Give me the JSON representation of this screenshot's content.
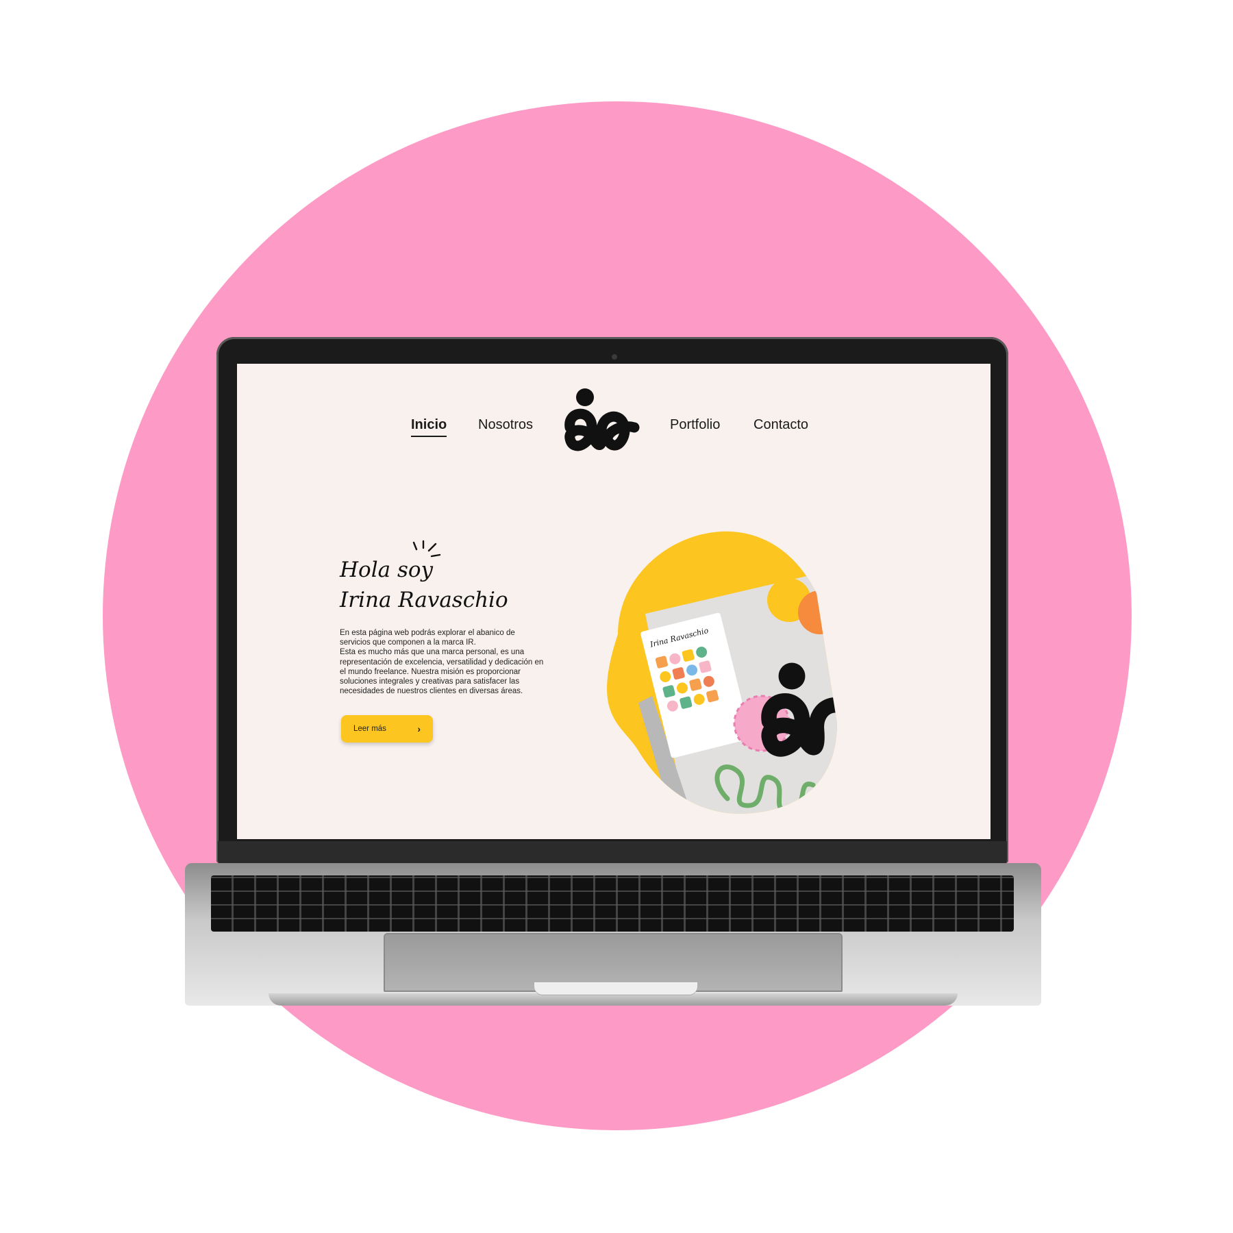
{
  "nav": {
    "items": [
      {
        "label": "Inicio",
        "active": true
      },
      {
        "label": "Nosotros"
      },
      {
        "label": "Portfolio"
      },
      {
        "label": "Contacto"
      }
    ]
  },
  "hero": {
    "greeting_line1": "Hola soy",
    "greeting_line2": "Irina Ravaschio",
    "intro": "En esta página web podrás explorar el abanico de servicios que componen a la marca IR.\nEsta es mucho más que una marca personal, es una representación de excelencia, versatilidad y dedicación en el mundo freelance. Nuestra misión es proporcionar soluciones integrales y creativas para satisfacer las necesidades de nuestros clientes en diversas áreas.",
    "cta_label": "Leer más",
    "cta_icon": "chevron-right-icon"
  },
  "illustration": {
    "card_title": "Irina Ravaschio"
  },
  "colors": {
    "background_circle": "#fd9bc6",
    "page_background": "#f8f1ee",
    "accent_yellow": "#fcc51f",
    "logo": "#111111"
  }
}
